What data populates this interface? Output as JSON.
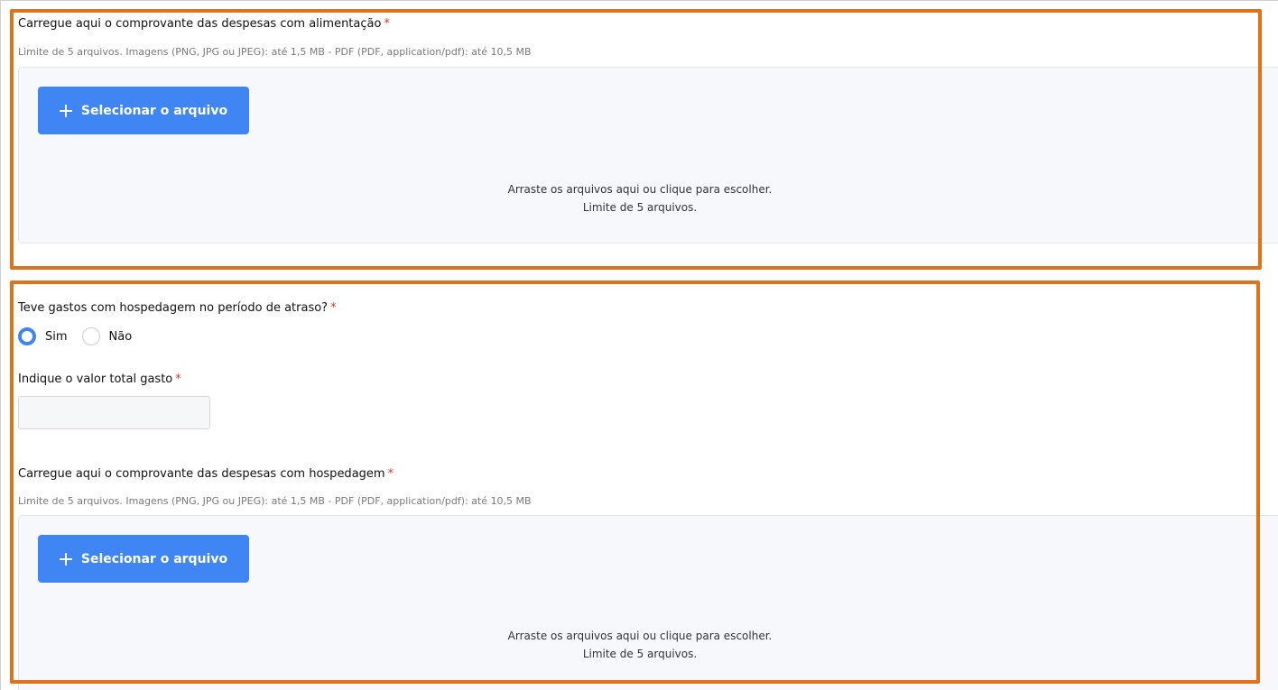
{
  "upload_alimentacao": {
    "label": "Carregue aqui o comprovante das despesas com alimentação",
    "required_mark": "*",
    "hint": "Limite de 5 arquivos. Imagens (PNG, JPG ou JPEG): até 1,5 MB - PDF (PDF, application/pdf): até 10,5 MB",
    "button_label": "Selecionar o arquivo",
    "drop_text_line1": "Arraste os arquivos aqui ou clique para escolher.",
    "drop_text_line2": "Limite de 5 arquivos."
  },
  "hospedagem_question": {
    "label": "Teve gastos com hospedagem no período de atraso?",
    "required_mark": "*",
    "options": [
      {
        "label": "Sim",
        "checked": true
      },
      {
        "label": "Não",
        "checked": false
      }
    ]
  },
  "valor_total": {
    "label": "Indique o valor total gasto",
    "required_mark": "*",
    "value": ""
  },
  "upload_hospedagem": {
    "label": "Carregue aqui o comprovante das despesas com hospedagem",
    "required_mark": "*",
    "hint": "Limite de 5 arquivos. Imagens (PNG, JPG ou JPEG): até 1,5 MB - PDF (PDF, application/pdf): até 10,5 MB",
    "button_label": "Selecionar o arquivo",
    "drop_text_line1": "Arraste os arquivos aqui ou clique para escolher.",
    "drop_text_line2": "Limite de 5 arquivos."
  },
  "colors": {
    "accent": "#3f86f4",
    "highlight_border": "#e0731a",
    "required": "#d9372b"
  },
  "icons": {
    "select_button": "plus-icon"
  }
}
